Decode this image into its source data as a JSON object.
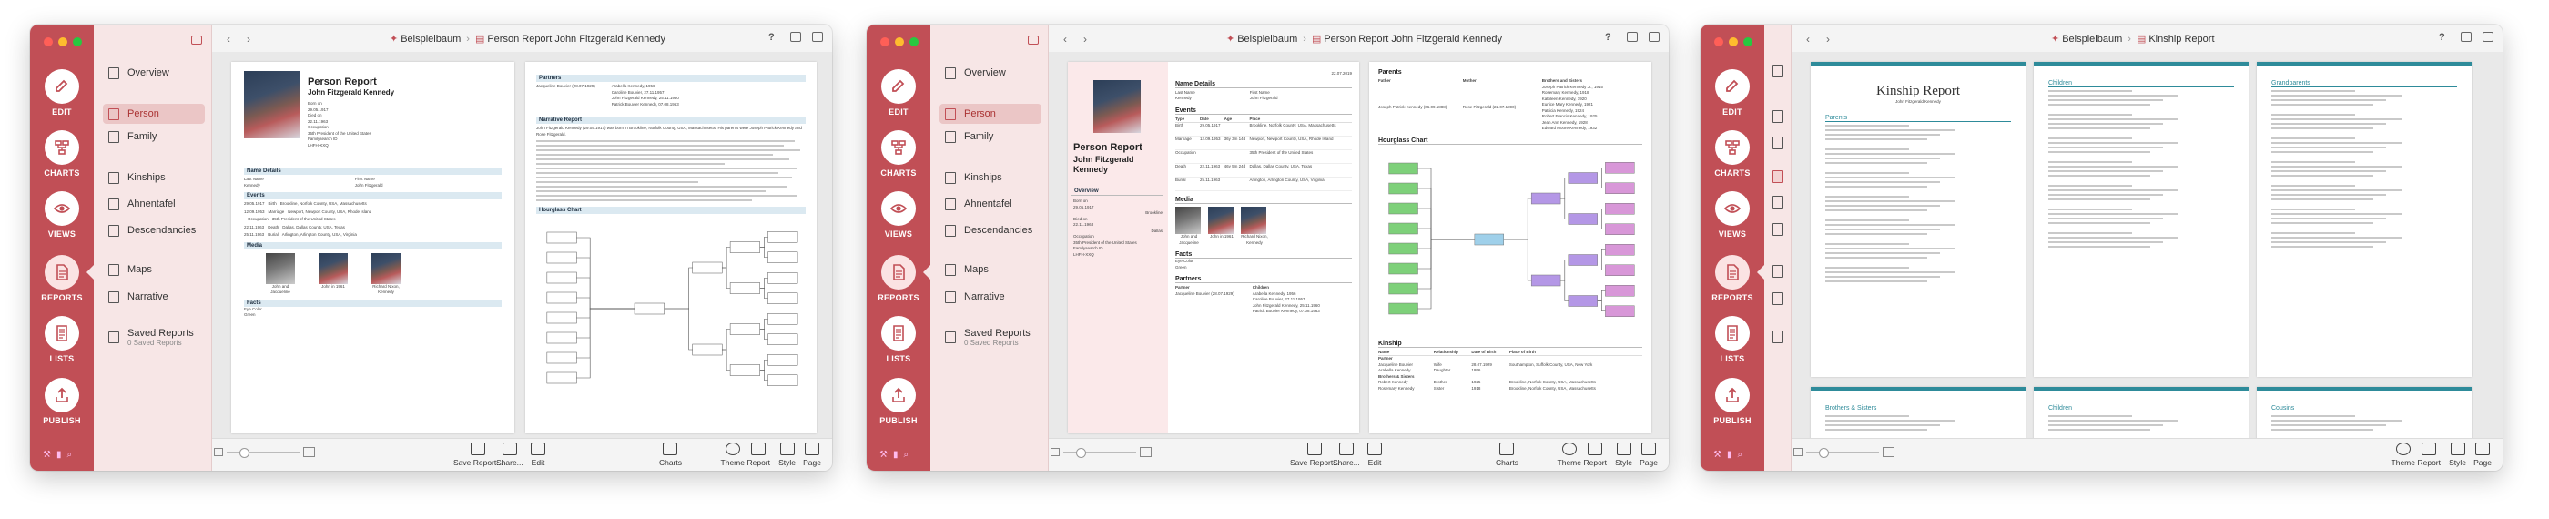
{
  "colors": {
    "accent": "#c14f56",
    "sidebar": "#f7e6e6",
    "section": "#dbe9f1",
    "kinship_bar": "#2e8b9a"
  },
  "rail": [
    {
      "label": "EDIT",
      "icon": "pencil-icon"
    },
    {
      "label": "CHARTS",
      "icon": "chart-icon"
    },
    {
      "label": "VIEWS",
      "icon": "eye-icon"
    },
    {
      "label": "REPORTS",
      "icon": "document-icon"
    },
    {
      "label": "LISTS",
      "icon": "list-icon"
    },
    {
      "label": "PUBLISH",
      "icon": "upload-icon"
    }
  ],
  "sidebar": {
    "items": [
      {
        "label": "Overview",
        "icon": "grid-icon"
      },
      {
        "label": "Person",
        "icon": "person-report-icon"
      },
      {
        "label": "Family",
        "icon": "family-report-icon"
      },
      {
        "label": "Kinships",
        "icon": "kinship-icon"
      },
      {
        "label": "Ahnentafel",
        "icon": "ahnentafel-icon"
      },
      {
        "label": "Descendancies",
        "icon": "descendancy-icon"
      },
      {
        "label": "Maps",
        "icon": "map-icon"
      },
      {
        "label": "Narrative",
        "icon": "narrative-icon"
      },
      {
        "label": "Saved Reports",
        "sublabel": "0 Saved Reports",
        "icon": "saved-reports-icon"
      }
    ]
  },
  "windows": [
    {
      "tree": "Beispielbaum",
      "report": "Person Report John Fitzgerald Kennedy"
    },
    {
      "tree": "Beispielbaum",
      "report": "Person Report John Fitzgerald Kennedy"
    },
    {
      "tree": "Beispielbaum",
      "report": "Kinship Report"
    }
  ],
  "bottombar": {
    "left": [
      {
        "label": "Save Report...",
        "icon": "save-icon"
      },
      {
        "label": "Share...",
        "icon": "share-icon"
      },
      {
        "label": "Edit",
        "icon": "edit-icon"
      }
    ],
    "charts": {
      "label": "Charts",
      "icon": "tree-chart-icon"
    },
    "right": [
      {
        "label": "Theme",
        "icon": "palette-icon"
      },
      {
        "label": "Report",
        "icon": "report-icon"
      },
      {
        "label": "Style",
        "icon": "style-icon"
      },
      {
        "label": "Page",
        "icon": "page-icon"
      }
    ]
  },
  "report": {
    "title": "Person Report",
    "name": "John Fitzgerald Kennedy",
    "sections": {
      "name_details": "Name Details",
      "events": "Events",
      "media": "Media",
      "facts": "Facts",
      "partners": "Partners",
      "narrative": "Narrative Report",
      "hourglass": "Hourglass Chart",
      "parents": "Parents",
      "kinship": "Kinship",
      "overview": "Overview"
    },
    "name_fields": {
      "last": "Last Name",
      "last_value": "Kennedy",
      "first": "First Name",
      "first_value": "John Fitzgerald"
    },
    "event_headers": [
      "Type",
      "Date",
      "Age",
      "Place"
    ],
    "events": [
      {
        "type": "Birth",
        "date": "29.05.1917",
        "age": "",
        "place": "Brookline, Norfolk County, USA, Massachusetts"
      },
      {
        "type": "Marriage",
        "date": "12.09.1953",
        "age": "36y 3m 14d",
        "place": "Newport, Newport County, USA, Rhode Island"
      },
      {
        "type": "Occupation",
        "date": "",
        "age": "",
        "place": "35th President of the United States"
      },
      {
        "type": "Death",
        "date": "22.11.1963",
        "age": "46y 5m 24d",
        "place": "Dallas, Dallas County, USA, Texas"
      },
      {
        "type": "Burial",
        "date": "25.11.1963",
        "age": "",
        "place": "Arlington, Arlington County, USA, Virginia"
      }
    ],
    "media_captions": [
      "John and Jacqueline",
      "John in 1961",
      "Richard Nixon, Kennedy"
    ],
    "facts": [
      {
        "label": "Eye Color",
        "value": "Green"
      }
    ],
    "partner_headers": [
      "Partner",
      "Children"
    ],
    "partner": "Jacqueline Bouvier (28.07.1929)",
    "children": [
      "Arabella Kennedy, 1956",
      "Caroline Bouvier, 27.11.1957",
      "John Fitzgerald Kennedy, 25.11.1960",
      "Patrick Bouvier Kennedy, 07.08.1963"
    ],
    "parent_headers": [
      "Father",
      "Mother",
      "Brothers and Sisters"
    ],
    "father": "Joseph Patrick Kennedy (06.09.1888)",
    "mother": "Rose Fitzgerald (22.07.1890)",
    "siblings": [
      "Joseph Patrick Kennedy Jr., 1915",
      "Rosemary Kennedy, 1918",
      "Kathleen Kennedy, 1920",
      "Eunice Mary Kennedy, 1921",
      "Patricia Kennedy, 1924",
      "Robert Francis Kennedy, 1925",
      "Jean Ann Kennedy, 1928",
      "Edward Moore Kennedy, 1932"
    ],
    "kinship_headers": [
      "Name",
      "Relationship",
      "Date of Birth",
      "Place of Birth"
    ],
    "kinship_groups": [
      "Partner",
      "Brothers & Sisters"
    ],
    "kinship_rows": [
      {
        "name": "Jacqueline Bouvier",
        "rel": "Wife",
        "dob": "28.07.1929",
        "pob": "Southampton, Suffolk County, USA, New York"
      },
      {
        "name": "Arabella Kennedy",
        "rel": "Daughter",
        "dob": "1956",
        "pob": ""
      },
      {
        "name": "Robert Kennedy",
        "rel": "Brother",
        "dob": "1925",
        "pob": "Brookline, Norfolk County, USA, Massachusetts"
      },
      {
        "name": "Rosemary Kennedy",
        "rel": "Sister",
        "dob": "1918",
        "pob": "Brookline, Norfolk County, USA, Massachusetts"
      }
    ],
    "date_stamp": "22.07.2019",
    "birth_label": "Born on",
    "birth_date": "29.05.1917",
    "birth_place": "Brookline",
    "death_label": "Died on",
    "death_date": "22.11.1963",
    "death_place": "Dallas",
    "occupation_label": "Occupation",
    "occupation": "35th President of the United States",
    "id_label": "Familysearch ID",
    "id_value": "LHFH-XXQ",
    "sheet_line": "John Fitzgerald Kennedy (29.05.1917) was born in Brookline, Norfolk County, USA, Massachusetts. His parents were Joseph Patrick Kennedy and Rose Fitzgerald."
  },
  "kinship_report": {
    "title": "Kinship Report",
    "subtitle": "John Fitzgerald Kennedy",
    "headings": [
      "Parents",
      "Brothers & Sisters",
      "Children",
      "Grandparents",
      "Grandchildren",
      "Cousins"
    ]
  }
}
